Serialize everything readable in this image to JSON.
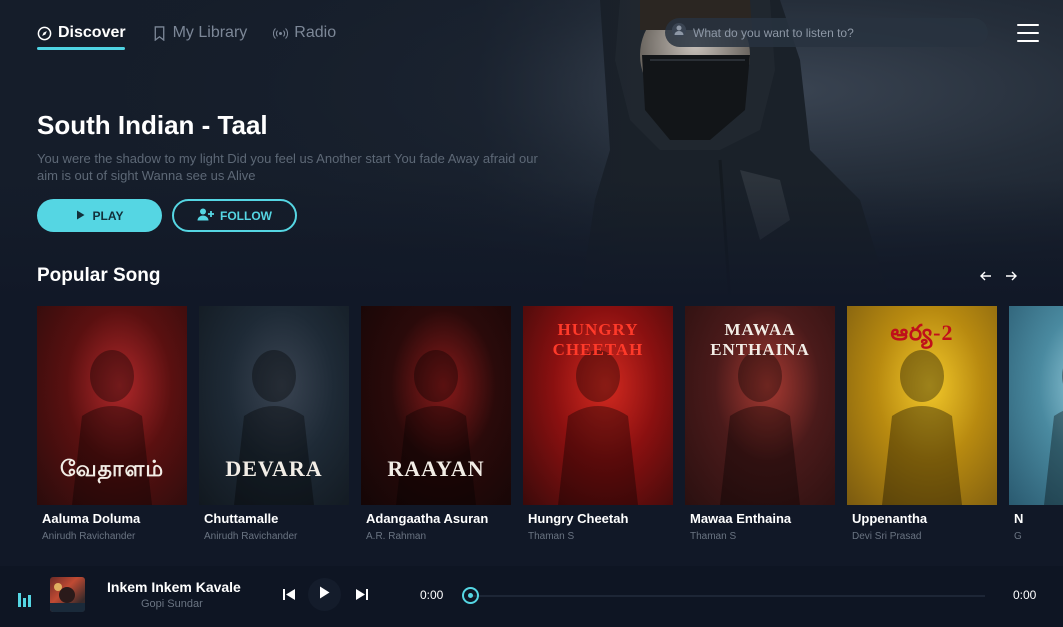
{
  "nav": {
    "items": [
      {
        "label": "Discover",
        "icon": "compass-icon",
        "active": true
      },
      {
        "label": "My Library",
        "icon": "bookmark-icon",
        "active": false
      },
      {
        "label": "Radio",
        "icon": "broadcast-icon",
        "active": false
      }
    ]
  },
  "search": {
    "placeholder": "What do you want to listen to?"
  },
  "hero": {
    "title": "South Indian - Taal",
    "description": "You were the shadow to my light Did you feel us Another start You fade Away afraid our aim is out of sight Wanna see us Alive",
    "play_label": "PLAY",
    "follow_label": "FOLLOW"
  },
  "popular": {
    "title": "Popular Song",
    "songs": [
      {
        "name": "Aaluma Doluma",
        "artist": "Anirudh Ravichander",
        "cover_text": "வேதாளம்",
        "colors": [
          "#5a1010",
          "#b0282a",
          "#2a0c0c"
        ]
      },
      {
        "name": "Chuttamalle",
        "artist": "Anirudh Ravichander",
        "cover_text": "DEVARA",
        "colors": [
          "#1e2a36",
          "#3a4452",
          "#11181f"
        ]
      },
      {
        "name": "Adangaatha Asuran",
        "artist": "A.R. Rahman",
        "cover_text": "RAAYAN",
        "colors": [
          "#2a0a0a",
          "#8a1a1a",
          "#140606"
        ]
      },
      {
        "name": "Hungry Cheetah",
        "artist": "Thaman S",
        "cover_text": "HUNGRY CHEETAH",
        "colors": [
          "#8a1010",
          "#d42a20",
          "#3a0a0a"
        ]
      },
      {
        "name": "Mawaa Enthaina",
        "artist": "Thaman S",
        "cover_text": "MAWAA ENTHAINA",
        "colors": [
          "#4a1a1a",
          "#a83a32",
          "#2a1010"
        ]
      },
      {
        "name": "Uppenantha",
        "artist": "Devi Sri Prasad",
        "cover_text": "ఆర్య-2",
        "colors": [
          "#b88a10",
          "#f2c82a",
          "#7a5a10"
        ]
      },
      {
        "name": "N",
        "artist": "G",
        "cover_text": "",
        "colors": [
          "#4a8aa0",
          "#9ad0e0",
          "#2a5a70"
        ]
      }
    ]
  },
  "player": {
    "title": "Inkem Inkem Kavale",
    "artist": "Gopi Sundar",
    "current_time": "0:00",
    "total_time": "0:00",
    "progress": 0
  },
  "accent_color": "#55d6e3"
}
